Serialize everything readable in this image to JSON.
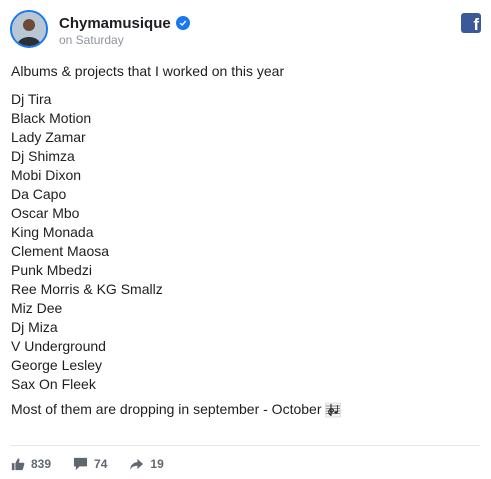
{
  "post": {
    "author": "Chymamusique",
    "time": "on Saturday",
    "intro": "Albums & projects that I worked on this year",
    "artists": [
      "Dj Tira",
      "Black Motion",
      "Lady Zamar",
      "Dj Shimza",
      "Mobi Dixon",
      "Da Capo",
      "Oscar Mbo",
      "King Monada",
      "Clement Maosa",
      "Punk Mbedzi",
      "Ree Morris & KG Smallz",
      "Miz Dee",
      "Dj Miza",
      "V Underground",
      "George Lesley",
      "Sax On Fleek"
    ],
    "outro": "Most of them are dropping in september - October",
    "outro_icon": "musical-score-icon"
  },
  "stats": {
    "likes": "839",
    "comments": "74",
    "shares": "19"
  },
  "icons": {
    "verified": "verified-badge-icon",
    "platform": "facebook-icon",
    "like": "thumbs-up-icon",
    "comment": "comment-bubble-icon",
    "share": "share-arrow-icon"
  },
  "colors": {
    "verified_blue": "#1877f2",
    "facebook_blue": "#3b5998",
    "meta_gray": "#90949c"
  }
}
